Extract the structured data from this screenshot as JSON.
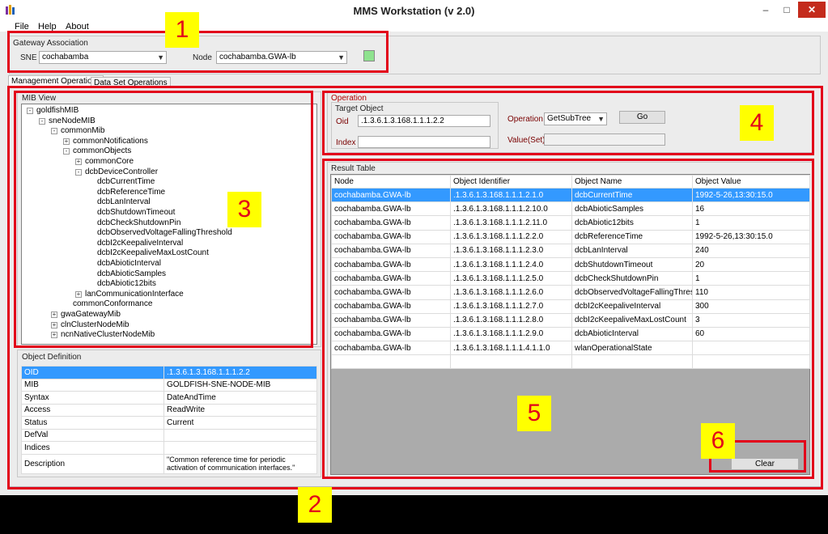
{
  "window": {
    "title": "MMS Workstation (v 2.0)",
    "minimize": "–",
    "maximize": "□",
    "close": "✕"
  },
  "menu": [
    "File",
    "Help",
    "About"
  ],
  "gateway": {
    "label": "Gateway Association",
    "sne_label": "SNE",
    "sne_value": "cochabamba",
    "node_label": "Node",
    "node_value": "cochabamba.GWA-lb",
    "status_color": "#8ee28e"
  },
  "tabs": [
    "Management Operations",
    "Data Set Operations"
  ],
  "mib_view": {
    "label": "MIB View",
    "items": [
      {
        "label": "goldfishMIB",
        "exp": "-"
      },
      {
        "label": "sneNodeMIB",
        "exp": "-"
      },
      {
        "label": "commonMib",
        "exp": "-"
      },
      {
        "label": "commonNotifications",
        "exp": "+"
      },
      {
        "label": "commonObjects",
        "exp": "-"
      },
      {
        "label": "commonCore",
        "exp": "+"
      },
      {
        "label": "dcbDeviceController",
        "exp": "-"
      },
      {
        "label": "dcbCurrentTime",
        "exp": ""
      },
      {
        "label": "dcbReferenceTime",
        "exp": ""
      },
      {
        "label": "dcbLanInterval",
        "exp": ""
      },
      {
        "label": "dcbShutdownTimeout",
        "exp": ""
      },
      {
        "label": "dcbCheckShutdownPin",
        "exp": ""
      },
      {
        "label": "dcbObservedVoltageFallingThreshold",
        "exp": ""
      },
      {
        "label": "dcbI2cKeepaliveInterval",
        "exp": ""
      },
      {
        "label": "dcbI2cKeepaliveMaxLostCount",
        "exp": ""
      },
      {
        "label": "dcbAbioticInterval",
        "exp": ""
      },
      {
        "label": "dcbAbioticSamples",
        "exp": ""
      },
      {
        "label": "dcbAbiotic12bits",
        "exp": ""
      },
      {
        "label": "lanCommunicationInterface",
        "exp": "+"
      },
      {
        "label": "commonConformance",
        "exp": ""
      },
      {
        "label": "gwaGatewayMib",
        "exp": "+"
      },
      {
        "label": "clnClusterNodeMib",
        "exp": "+"
      },
      {
        "label": "ncnNativeClusterNodeMib",
        "exp": "+"
      }
    ]
  },
  "object_definition": {
    "label": "Object Definition",
    "rows": [
      {
        "key": "OID",
        "value": ".1.3.6.1.3.168.1.1.1.2.2"
      },
      {
        "key": "MIB",
        "value": "GOLDFISH-SNE-NODE-MIB"
      },
      {
        "key": "Syntax",
        "value": "DateAndTime"
      },
      {
        "key": "Access",
        "value": "ReadWrite"
      },
      {
        "key": "Status",
        "value": "Current"
      },
      {
        "key": "DefVal",
        "value": ""
      },
      {
        "key": "Indices",
        "value": ""
      },
      {
        "key": "Description",
        "value": "\"Common reference time for periodic activation of communication interfaces.\""
      }
    ]
  },
  "operation": {
    "label": "Operation",
    "target_label": "Target Object",
    "oid_label": "Oid",
    "oid_value": ".1.3.6.1.3.168.1.1.1.2.2",
    "index_label": "Index",
    "index_value": "",
    "op_label": "Operation",
    "op_value": "GetSubTree",
    "go_label": "Go",
    "valueset_label": "Value(Set)",
    "valueset_value": ""
  },
  "result_table": {
    "label": "Result Table",
    "headers": [
      "Node",
      "Object Identifier",
      "Object Name",
      "Object Value"
    ],
    "rows": [
      [
        "cochabamba.GWA-lb",
        ".1.3.6.1.3.168.1.1.1.2.1.0",
        "dcbCurrentTime",
        "1992-5-26,13:30:15.0"
      ],
      [
        "cochabamba.GWA-lb",
        ".1.3.6.1.3.168.1.1.1.2.10.0",
        "dcbAbioticSamples",
        "16"
      ],
      [
        "cochabamba.GWA-lb",
        ".1.3.6.1.3.168.1.1.1.2.11.0",
        "dcbAbiotic12bits",
        "1"
      ],
      [
        "cochabamba.GWA-lb",
        ".1.3.6.1.3.168.1.1.1.2.2.0",
        "dcbReferenceTime",
        "1992-5-26,13:30:15.0"
      ],
      [
        "cochabamba.GWA-lb",
        ".1.3.6.1.3.168.1.1.1.2.3.0",
        "dcbLanInterval",
        "240"
      ],
      [
        "cochabamba.GWA-lb",
        ".1.3.6.1.3.168.1.1.1.2.4.0",
        "dcbShutdownTimeout",
        "20"
      ],
      [
        "cochabamba.GWA-lb",
        ".1.3.6.1.3.168.1.1.1.2.5.0",
        "dcbCheckShutdownPin",
        "1"
      ],
      [
        "cochabamba.GWA-lb",
        ".1.3.6.1.3.168.1.1.1.2.6.0",
        "dcbObservedVoltageFallingThreshold",
        "110"
      ],
      [
        "cochabamba.GWA-lb",
        ".1.3.6.1.3.168.1.1.1.2.7.0",
        "dcbI2cKeepaliveInterval",
        "300"
      ],
      [
        "cochabamba.GWA-lb",
        ".1.3.6.1.3.168.1.1.1.2.8.0",
        "dcbI2cKeepaliveMaxLostCount",
        "3"
      ],
      [
        "cochabamba.GWA-lb",
        ".1.3.6.1.3.168.1.1.1.2.9.0",
        "dcbAbioticInterval",
        "60"
      ],
      [
        "cochabamba.GWA-lb",
        ".1.3.6.1.3.168.1.1.1.4.1.1.0",
        "wlanOperationalState",
        ""
      ],
      [
        "",
        "",
        "",
        ""
      ]
    ],
    "clear_label": "Clear"
  },
  "annotations": [
    "1",
    "2",
    "3",
    "4",
    "5",
    "6"
  ],
  "colors": {
    "highlight": "#e2001a",
    "badge": "#ffff00",
    "selection": "#3399ff"
  }
}
